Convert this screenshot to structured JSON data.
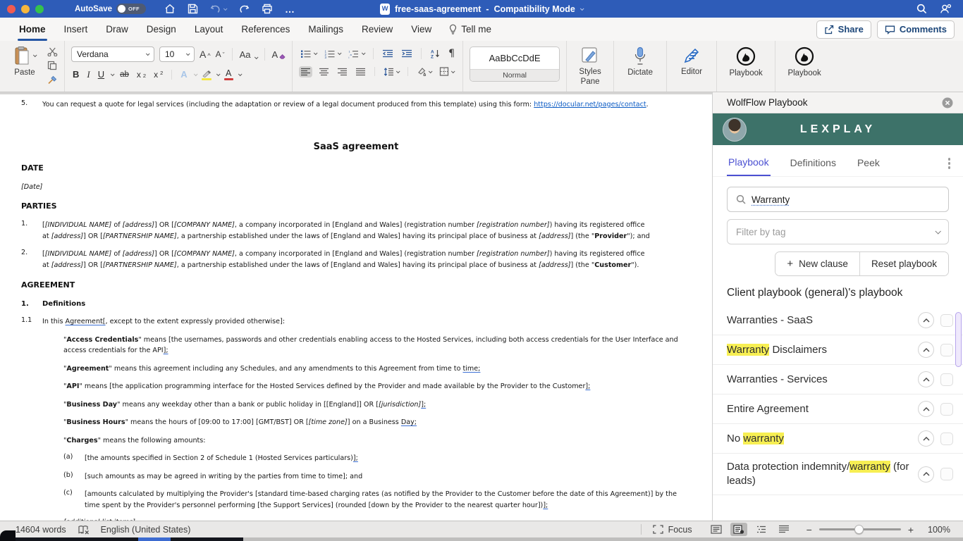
{
  "colors": {
    "titlebar_blue": "#2e5cb8",
    "brand_teal": "#3d7269",
    "accent_indigo": "#4b50d2",
    "highlight_yellow": "#f7ef53",
    "active_tab_underline": "#2456a4"
  },
  "titlebar": {
    "autosave_label": "AutoSave",
    "autosave_state": "OFF",
    "doc_icon_letter": "W",
    "doc_title": "free-saas-agreement",
    "separator": "-",
    "mode": "Compatibility Mode",
    "ellipsis": "…"
  },
  "ribbon": {
    "tabs": [
      "Home",
      "Insert",
      "Draw",
      "Design",
      "Layout",
      "References",
      "Mailings",
      "Review",
      "View"
    ],
    "tell_me": "Tell me",
    "share": "Share",
    "comments": "Comments",
    "paste_label": "Paste",
    "font_name": "Verdana",
    "font_size": "10",
    "glyphs": {
      "grow_font": "A",
      "shrink_font": "A",
      "change_case": "Aa",
      "clear_format": "A",
      "bold": "B",
      "italic": "I",
      "underline": "U",
      "strikethrough": "ab",
      "sub_base": "x",
      "sub_small": "2",
      "sup_base": "x",
      "sup_small": "2",
      "text_effects": "A",
      "font_color": "A",
      "sort_a": "A",
      "sort_z": "Z",
      "pilcrow": "¶"
    },
    "style_preview": "AaBbCcDdE",
    "style_name": "Normal",
    "styles_pane": "Styles Pane",
    "dictate": "Dictate",
    "editor": "Editor",
    "playbook_1": "Playbook",
    "playbook_2": "Playbook"
  },
  "document": {
    "notice": {
      "num": "5.",
      "segments": [
        {
          "t": "You can request a quote for legal services (including the adaptation or review of a legal document produced from this template) using this form: "
        },
        {
          "t": "https://docular.net/pages/contact",
          "s": "link"
        },
        {
          "t": "."
        }
      ]
    },
    "title": "SaaS agreement",
    "date_heading": "DATE",
    "date_value": [
      {
        "t": "[Date]",
        "s": "i"
      }
    ],
    "parties_heading": "PARTIES",
    "parties": [
      {
        "num": "1.",
        "lines": [
          [
            {
              "t": "["
            },
            {
              "t": "[INDIVIDUAL NAME]",
              "s": "i"
            },
            {
              "t": " of "
            },
            {
              "t": "[address]",
              "s": "i"
            },
            {
              "t": "] OR ["
            },
            {
              "t": "[COMPANY NAME]",
              "s": "i"
            },
            {
              "t": ", a company incorporated in [England and Wales] (registration number "
            },
            {
              "t": "[registration number]",
              "s": "i"
            },
            {
              "t": ") having its registered office"
            }
          ],
          [
            {
              "t": "at "
            },
            {
              "t": "[address]",
              "s": "i"
            },
            {
              "t": "] OR ["
            },
            {
              "t": "[PARTNERSHIP NAME]",
              "s": "i"
            },
            {
              "t": ", a partnership established under the laws of [England and Wales] having its principal place of business at "
            },
            {
              "t": "[address]",
              "s": "i"
            },
            {
              "t": "] (the \""
            },
            {
              "t": "Provider",
              "s": "b"
            },
            {
              "t": "\"); and"
            }
          ]
        ]
      },
      {
        "num": "2.",
        "lines": [
          [
            {
              "t": "["
            },
            {
              "t": "[INDIVIDUAL NAME]",
              "s": "i"
            },
            {
              "t": " of "
            },
            {
              "t": "[address]",
              "s": "i"
            },
            {
              "t": "] OR ["
            },
            {
              "t": "[COMPANY NAME]",
              "s": "i"
            },
            {
              "t": ", a company incorporated in [England and Wales] (registration number "
            },
            {
              "t": "[registration number]",
              "s": "i"
            },
            {
              "t": ") having its registered office"
            }
          ],
          [
            {
              "t": "at "
            },
            {
              "t": "[address]",
              "s": "i"
            },
            {
              "t": "] OR ["
            },
            {
              "t": "[PARTNERSHIP NAME]",
              "s": "i"
            },
            {
              "t": ", a partnership established under the laws of [England and Wales] having its principal place of business at "
            },
            {
              "t": "[address]",
              "s": "i"
            },
            {
              "t": "] (the \""
            },
            {
              "t": "Customer",
              "s": "b"
            },
            {
              "t": "\")."
            }
          ]
        ]
      }
    ],
    "agreement_heading": "AGREEMENT",
    "clause1_num": "1.",
    "clause1_title": "Definitions",
    "clause11_num": "1.1",
    "clause11_line": [
      {
        "t": "In this "
      },
      {
        "t": "Agreement[",
        "s": "u"
      },
      {
        "t": ", except to the extent expressly provided otherwise]:"
      }
    ],
    "definitions": [
      {
        "lines": [
          [
            {
              "t": "\""
            },
            {
              "t": "Access Credentials",
              "s": "b"
            },
            {
              "t": "\" means [the usernames, passwords and other credentials enabling access to the Hosted Services, including both access credentials for the User Interface and"
            }
          ],
          [
            {
              "t": "access credentials for the API"
            },
            {
              "t": "];",
              "s": "u"
            }
          ]
        ]
      },
      {
        "lines": [
          [
            {
              "t": "\""
            },
            {
              "t": "Agreement",
              "s": "b"
            },
            {
              "t": "\" means this agreement including any Schedules, and any amendments to this Agreement from time to "
            },
            {
              "t": "time;",
              "s": "u"
            }
          ]
        ]
      },
      {
        "lines": [
          [
            {
              "t": "\""
            },
            {
              "t": "API",
              "s": "b"
            },
            {
              "t": "\" means [the application programming interface for the Hosted Services defined by the Provider and made available by the Provider to the Customer"
            },
            {
              "t": "];",
              "s": "u"
            }
          ]
        ]
      },
      {
        "lines": [
          [
            {
              "t": "\""
            },
            {
              "t": "Business Day",
              "s": "b"
            },
            {
              "t": "\" means any weekday other than a bank or public holiday in [[England]] OR ["
            },
            {
              "t": "[jurisdiction]",
              "s": "i"
            },
            {
              "t": "];",
              "s": "u"
            }
          ]
        ]
      },
      {
        "lines": [
          [
            {
              "t": "\""
            },
            {
              "t": "Business Hours",
              "s": "b"
            },
            {
              "t": "\" means the hours of [09:00 to 17:00] [GMT/BST] OR ["
            },
            {
              "t": "[time zone]",
              "s": "i"
            },
            {
              "t": "] on a Business "
            },
            {
              "t": "Day;",
              "s": "u"
            }
          ]
        ]
      },
      {
        "lines": [
          [
            {
              "t": "\""
            },
            {
              "t": "Charges",
              "s": "b"
            },
            {
              "t": "\" means the following amounts:"
            }
          ]
        ]
      }
    ],
    "list_items": [
      {
        "label": "(a)",
        "lines": [
          [
            {
              "t": "[the amounts specified in Section 2 of Schedule 1 (Hosted Services particulars)"
            },
            {
              "t": "];",
              "s": "u"
            }
          ]
        ]
      },
      {
        "label": "(b)",
        "lines": [
          [
            {
              "t": "[such amounts as may be agreed in writing by the parties from time to time]; and"
            }
          ]
        ]
      },
      {
        "label": "(c)",
        "lines": [
          [
            {
              "t": "[amounts calculated by multiplying the Provider's [standard time-based charging rates (as notified by the Provider to the Customer before the date of this Agreement)] by the"
            }
          ],
          [
            {
              "t": "time spent by the Provider's personnel performing [the Support Services] (rounded [down by the Provider to the nearest quarter hour])"
            },
            {
              "t": "];",
              "s": "u"
            }
          ]
        ]
      }
    ],
    "additional": [
      {
        "t": "[additional list items]",
        "s": "i"
      }
    ]
  },
  "panel": {
    "title": "WolfFlow Playbook",
    "brand": "LEXPLAY",
    "tabs": [
      "Playbook",
      "Definitions",
      "Peek"
    ],
    "search_value": "Warranty",
    "filter_placeholder": "Filter by tag",
    "new_clause": "New clause",
    "plus": "+",
    "reset_playbook": "Reset playbook",
    "playbook_heading": "Client playbook (general)'s playbook",
    "clauses": [
      {
        "segments": [
          {
            "t": "Warranties - SaaS"
          }
        ]
      },
      {
        "segments": [
          {
            "t": "Warranty",
            "s": "hl"
          },
          {
            "t": " Disclaimers"
          }
        ]
      },
      {
        "segments": [
          {
            "t": "Warranties - Services"
          }
        ]
      },
      {
        "segments": [
          {
            "t": "Entire Agreement"
          }
        ]
      },
      {
        "segments": [
          {
            "t": "No "
          },
          {
            "t": "warranty",
            "s": "hl"
          }
        ]
      },
      {
        "segments": [
          {
            "t": "Data protection indemnity/"
          },
          {
            "t": "warranty",
            "s": "hl"
          },
          {
            "t": " (for leads)"
          }
        ]
      }
    ]
  },
  "statusbar": {
    "word_count": "14604 words",
    "language": "English (United States)",
    "focus": "Focus",
    "zoom_out": "−",
    "zoom_in": "+",
    "zoom_level": "100%"
  }
}
